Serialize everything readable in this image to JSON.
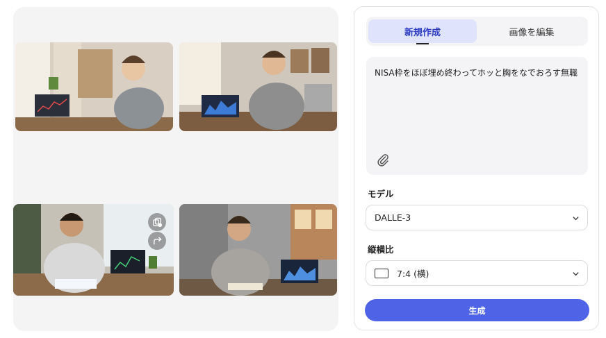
{
  "tabs": {
    "new": "新規作成",
    "edit": "画像を編集"
  },
  "prompt": {
    "text": "NISA枠をほぼ埋め終わってホッと胸をなでおろす無職"
  },
  "model": {
    "label": "モデル",
    "value": "DALLE-3"
  },
  "aspect": {
    "label": "縦横比",
    "value": "7:4 (横)"
  },
  "generate_label": "生成",
  "colors": {
    "accent": "#4f63e6",
    "active_tab_bg": "#dfe3fb",
    "panel_bg": "#f4f4f6"
  },
  "gallery": {
    "images": [
      {
        "name": "generated-image-1"
      },
      {
        "name": "generated-image-2"
      },
      {
        "name": "generated-image-3"
      },
      {
        "name": "generated-image-4"
      }
    ],
    "overlay_icons": [
      "copy-variation-icon",
      "share-icon"
    ]
  }
}
